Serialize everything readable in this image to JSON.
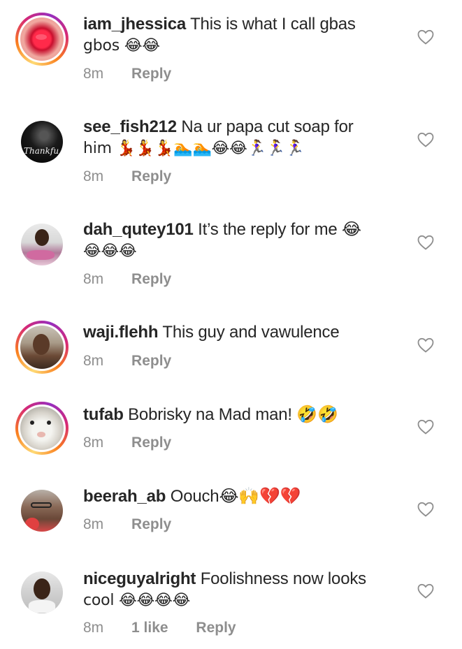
{
  "comments": [
    {
      "username": "iam_jhessica",
      "line1": "This is what I call gbas",
      "line2": "gbos 😂😂",
      "time": "8m",
      "likes": "",
      "reply": "Reply",
      "avatar": "red-lips-avatar",
      "story_ring": true
    },
    {
      "username": "see_fish212",
      "line1": "Na ur papa cut soap for",
      "line2": "him 💃💃💃🏊🏊😂😂🏃‍♀️🏃‍♀️🏃‍♀️",
      "time": "8m",
      "likes": "",
      "reply": "Reply",
      "avatar": "thankful-avatar",
      "avatar_text": "Thankfu",
      "story_ring": false
    },
    {
      "username": "dah_qutey101",
      "line1": "It’s the reply for me 😂",
      "line2": "😂😂😂",
      "time": "8m",
      "likes": "",
      "reply": "Reply",
      "avatar": "woman-flowers-avatar",
      "story_ring": false
    },
    {
      "username": "waji.flehh",
      "line1": "This guy and vawulence",
      "line2": "",
      "time": "8m",
      "likes": "",
      "reply": "Reply",
      "avatar": "young-man-avatar",
      "story_ring": true
    },
    {
      "username": "tufab",
      "line1": "Bobrisky na Mad man! 🤣🤣",
      "line2": "",
      "time": "8m",
      "likes": "",
      "reply": "Reply",
      "avatar": "goat-avatar",
      "story_ring": true
    },
    {
      "username": "beerah_ab",
      "line1": "Oouch😂🙌💔💔",
      "line2": "",
      "time": "8m",
      "likes": "",
      "reply": "Reply",
      "avatar": "woman-glasses-avatar",
      "story_ring": false
    },
    {
      "username": "niceguyalright",
      "line1": "Foolishness now looks",
      "line2": "cool 😂😂😂😂",
      "time": "8m",
      "likes": "1 like",
      "reply": "Reply",
      "avatar": "man-portrait-avatar",
      "story_ring": false
    }
  ],
  "colors": {
    "text": "#262626",
    "meta": "#8e8e8e",
    "background": "#ffffff"
  },
  "icons": {
    "like": "heart-outline-icon"
  }
}
